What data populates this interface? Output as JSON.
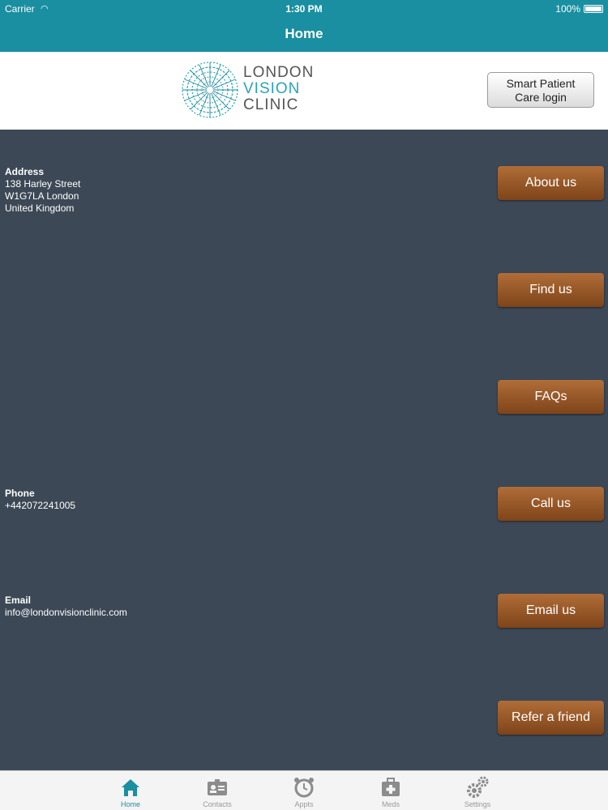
{
  "status_bar": {
    "carrier": "Carrier",
    "time": "1:30 PM",
    "battery": "100%"
  },
  "nav": {
    "title": "Home"
  },
  "logo": {
    "line1": "LONDON",
    "line2": "VISION",
    "line3": "CLINIC",
    "accent": "#2aa3b8"
  },
  "patient_login": {
    "label": "Smart Patient\nCare login"
  },
  "address": {
    "label": "Address",
    "value": "138 Harley Street\nW1G7LA London\nUnited Kingdom"
  },
  "phone": {
    "label": "Phone",
    "value": "+442072241005"
  },
  "email": {
    "label": "Email",
    "value": "info@londonvisionclinic.com"
  },
  "buttons": {
    "about": "About us",
    "find": "Find us",
    "faqs": "FAQs",
    "call": "Call us",
    "email": "Email us",
    "refer": "Refer a friend"
  },
  "tabs": [
    {
      "label": "Home",
      "icon": "home-icon",
      "active": true
    },
    {
      "label": "Contacts",
      "icon": "contacts-icon",
      "active": false
    },
    {
      "label": "Appts",
      "icon": "alarm-clock-icon",
      "active": false
    },
    {
      "label": "Meds",
      "icon": "medical-kit-icon",
      "active": false
    },
    {
      "label": "Settings",
      "icon": "gears-icon",
      "active": false
    }
  ],
  "colors": {
    "bar": "#1a8fa1",
    "background": "#3c4856",
    "button": "#9a5a2a"
  }
}
